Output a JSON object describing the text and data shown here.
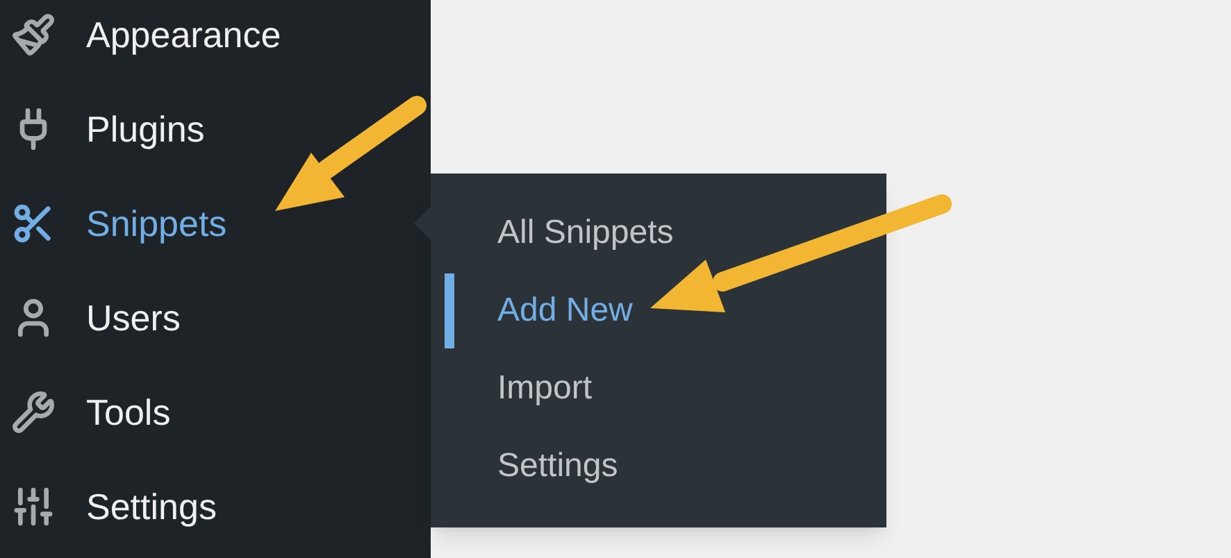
{
  "sidebar": {
    "items": [
      {
        "label": "Appearance",
        "selected": false
      },
      {
        "label": "Plugins",
        "selected": false
      },
      {
        "label": "Snippets",
        "selected": true
      },
      {
        "label": "Users",
        "selected": false
      },
      {
        "label": "Tools",
        "selected": false
      },
      {
        "label": "Settings",
        "selected": false
      }
    ]
  },
  "submenu": {
    "items": [
      {
        "label": "All Snippets",
        "selected": false
      },
      {
        "label": "Add New",
        "selected": true
      },
      {
        "label": "Import",
        "selected": false
      },
      {
        "label": "Settings",
        "selected": false
      }
    ]
  }
}
